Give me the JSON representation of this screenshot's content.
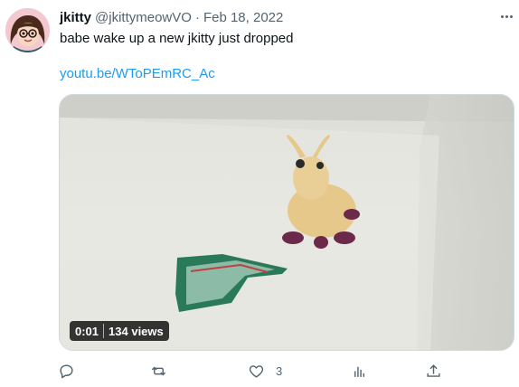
{
  "tweet": {
    "display_name": "jkitty",
    "handle": "@jkittymeowVO",
    "separator": "·",
    "date": "Feb 18, 2022",
    "text": "babe wake up a new jkitty just dropped",
    "link": "youtu.be/WToPEmRC_Ac"
  },
  "video": {
    "timestamp": "0:01",
    "views": "134 views"
  },
  "actions": {
    "reply_icon": "reply-icon",
    "retweet_icon": "retweet-icon",
    "like_icon": "heart-icon",
    "like_count": "3",
    "views_icon": "analytics-icon",
    "share_icon": "share-icon"
  },
  "colors": {
    "text_primary": "#0f1419",
    "text_secondary": "#536471",
    "link": "#1d9bf0"
  }
}
